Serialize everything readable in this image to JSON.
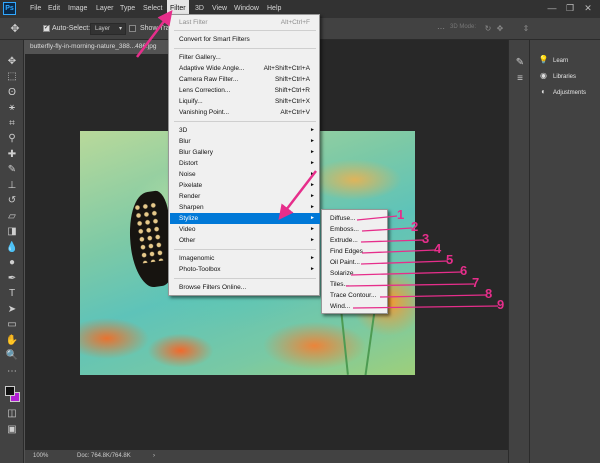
{
  "app": {
    "logo": "Ps"
  },
  "menubar": {
    "items": [
      "File",
      "Edit",
      "Image",
      "Layer",
      "Type",
      "Select",
      "Filter",
      "3D",
      "View",
      "Window",
      "Help"
    ],
    "active": "Filter",
    "window_controls": {
      "minimize": "—",
      "restore": "❐",
      "close": "✕"
    }
  },
  "options_bar": {
    "auto_select_label": "Auto-Select:",
    "auto_select_checked": true,
    "layer_select_value": "Layer",
    "show_transform_label": "Show Tra",
    "mode_3d_label": "3D Mode:"
  },
  "document": {
    "tab_title": "butterfly-fly-in-morning-nature_388...486.jpg",
    "zoom": "100%",
    "doc_size": "Doc: 764.8K/764.8K"
  },
  "filter_menu": {
    "items": [
      {
        "label": "Last Filter",
        "shortcut": "Alt+Ctrl+F",
        "disabled": true
      },
      {
        "label": "Convert for Smart Filters"
      },
      {
        "label": "Filter Gallery..."
      },
      {
        "label": "Adaptive Wide Angle...",
        "shortcut": "Alt+Shift+Ctrl+A"
      },
      {
        "label": "Camera Raw Filter...",
        "shortcut": "Shift+Ctrl+A"
      },
      {
        "label": "Lens Correction...",
        "shortcut": "Shift+Ctrl+R"
      },
      {
        "label": "Liquify...",
        "shortcut": "Shift+Ctrl+X"
      },
      {
        "label": "Vanishing Point...",
        "shortcut": "Alt+Ctrl+V"
      },
      {
        "label": "3D",
        "submenu": true
      },
      {
        "label": "Blur",
        "submenu": true
      },
      {
        "label": "Blur Gallery",
        "submenu": true
      },
      {
        "label": "Distort",
        "submenu": true
      },
      {
        "label": "Noise",
        "submenu": true
      },
      {
        "label": "Pixelate",
        "submenu": true
      },
      {
        "label": "Render",
        "submenu": true
      },
      {
        "label": "Sharpen",
        "submenu": true
      },
      {
        "label": "Stylize",
        "submenu": true,
        "highlighted": true
      },
      {
        "label": "Video",
        "submenu": true
      },
      {
        "label": "Other",
        "submenu": true
      },
      {
        "label": "Imagenomic",
        "submenu": true
      },
      {
        "label": "Photo-Toolbox",
        "submenu": true
      },
      {
        "label": "Browse Filters Online..."
      }
    ],
    "submenu_arrow": "►"
  },
  "stylize_submenu": {
    "items": [
      "Diffuse...",
      "Emboss...",
      "Extrude...",
      "Find Edges",
      "Oil Paint...",
      "Solarize",
      "Tiles...",
      "Trace Contour...",
      "Wind..."
    ]
  },
  "annotations": {
    "numbers": [
      "1",
      "2",
      "3",
      "4",
      "5",
      "6",
      "7",
      "8",
      "9"
    ],
    "color": "#e62e8b"
  },
  "right_panels": {
    "items": [
      {
        "label": "Learn",
        "icon": "lightbulb-icon"
      },
      {
        "label": "Libraries",
        "icon": "libraries-icon"
      },
      {
        "label": "Adjustments",
        "icon": "adjustments-icon"
      }
    ]
  },
  "tools": [
    "move-tool",
    "marquee-tool",
    "lasso-tool",
    "magic-wand-tool",
    "crop-tool",
    "eyedropper-tool",
    "healing-brush-tool",
    "brush-tool",
    "clone-stamp-tool",
    "history-brush-tool",
    "eraser-tool",
    "gradient-tool",
    "blur-tool",
    "dodge-tool",
    "pen-tool",
    "type-tool",
    "path-selection-tool",
    "rectangle-tool",
    "hand-tool",
    "zoom-tool"
  ],
  "colors": {
    "accent": "#0078d7",
    "foreground": "#111111",
    "background": "#b11fd3"
  }
}
